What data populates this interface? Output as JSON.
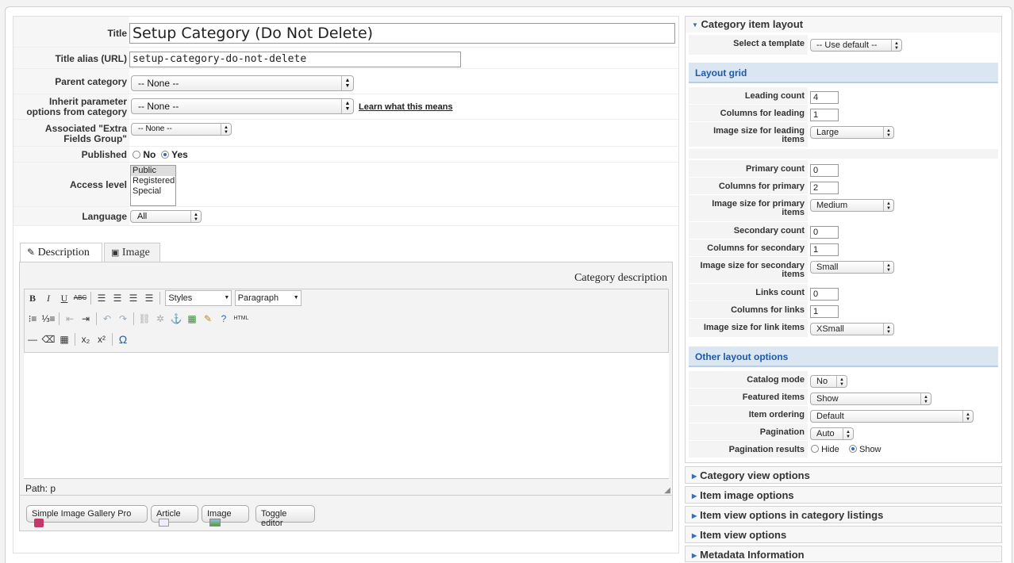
{
  "form": {
    "title_label": "Title",
    "title_value": "Setup Category (Do Not Delete)",
    "alias_label": "Title alias (URL)",
    "alias_value": "setup-category-do-not-delete",
    "parent_label": "Parent category",
    "parent_value": "-- None --",
    "inherit_label_1": "Inherit parameter",
    "inherit_label_2": "options from category",
    "inherit_value": "-- None --",
    "learn_link": "Learn what this means",
    "extra_label_1": "Associated \"Extra",
    "extra_label_2": "Fields Group\"",
    "extra_value": "-- None --",
    "published_label": "Published",
    "published_no": "No",
    "published_yes": "Yes",
    "access_label": "Access level",
    "access_options": [
      "Public",
      "Registered",
      "Special"
    ],
    "language_label": "Language",
    "language_value": "All"
  },
  "tabs": {
    "description": "Description",
    "image": "Image"
  },
  "editor": {
    "header": "Category description",
    "styles": "Styles",
    "paragraph": "Paragraph",
    "html_label": "HTML",
    "path": "Path: p",
    "buttons": {
      "gallery": "Simple Image Gallery Pro",
      "article": "Article",
      "image": "Image",
      "toggle": "Toggle editor"
    }
  },
  "right": {
    "item_layout_title": "Category item layout",
    "select_template_label": "Select a template",
    "select_template_value": "-- Use default --",
    "layout_grid_title": "Layout grid",
    "leading_count_label": "Leading count",
    "leading_count": "4",
    "columns_leading_label": "Columns for leading",
    "columns_leading": "1",
    "img_leading_label_1": "Image size for leading",
    "img_leading_label_2": "items",
    "img_leading": "Large",
    "primary_count_label": "Primary count",
    "primary_count": "0",
    "columns_primary_label": "Columns for primary",
    "columns_primary": "2",
    "img_primary_label_1": "Image size for primary",
    "img_primary_label_2": "items",
    "img_primary": "Medium",
    "secondary_count_label": "Secondary count",
    "secondary_count": "0",
    "columns_secondary_label": "Columns for secondary",
    "columns_secondary": "1",
    "img_secondary_label_1": "Image size for secondary",
    "img_secondary_label_2": "items",
    "img_secondary": "Small",
    "links_count_label": "Links count",
    "links_count": "0",
    "columns_links_label": "Columns for links",
    "columns_links": "1",
    "img_links_label": "Image size for link items",
    "img_links": "XSmall",
    "other_title": "Other layout options",
    "catalog_label": "Catalog mode",
    "catalog_value": "No",
    "featured_label": "Featured items",
    "featured_value": "Show",
    "ordering_label": "Item ordering",
    "ordering_value": "Default",
    "pagination_label": "Pagination",
    "pagination_value": "Auto",
    "pag_results_label": "Pagination results",
    "pag_hide": "Hide",
    "pag_show": "Show",
    "collapsed": [
      "Category view options",
      "Item image options",
      "Item view options in category listings",
      "Item view options",
      "Metadata Information"
    ]
  },
  "colors": {
    "accent": "#1e5aa8",
    "section_bg": "#dbe6f3"
  }
}
